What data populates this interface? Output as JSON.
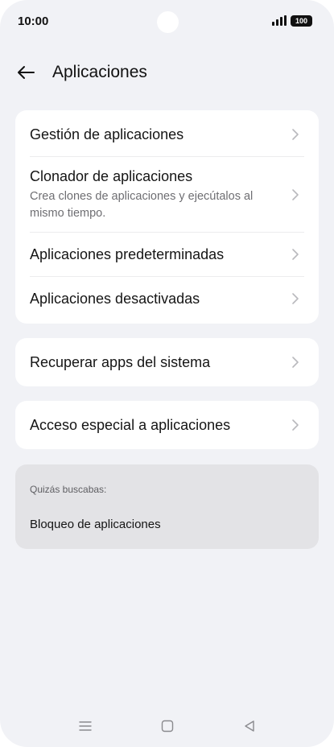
{
  "status_bar": {
    "time": "10:00",
    "battery": "100"
  },
  "header": {
    "title": "Aplicaciones"
  },
  "cards": [
    {
      "items": [
        {
          "label": "Gestión de aplicaciones"
        },
        {
          "label": "Clonador de aplicaciones",
          "subtitle": "Crea clones de aplicaciones y ejecútalos al mismo tiempo."
        },
        {
          "label": "Aplicaciones predeterminadas"
        },
        {
          "label": "Aplicaciones desactivadas"
        }
      ]
    },
    {
      "items": [
        {
          "label": "Recuperar apps del sistema"
        }
      ]
    },
    {
      "items": [
        {
          "label": "Acceso especial a aplicaciones"
        }
      ]
    }
  ],
  "suggestion": {
    "heading": "Quizás buscabas:",
    "link": "Bloqueo de aplicaciones"
  },
  "icons": {
    "back": "back-arrow-icon",
    "chevron": "chevron-right-icon",
    "signal": "signal-icon",
    "nav_menu": "menu-icon",
    "nav_home": "home-icon",
    "nav_back": "back-triangle-icon"
  },
  "colors": {
    "background": "#f1f2f6",
    "card": "#ffffff",
    "suggestion_card": "#e3e3e6",
    "chevron": "#b9b9bd"
  }
}
